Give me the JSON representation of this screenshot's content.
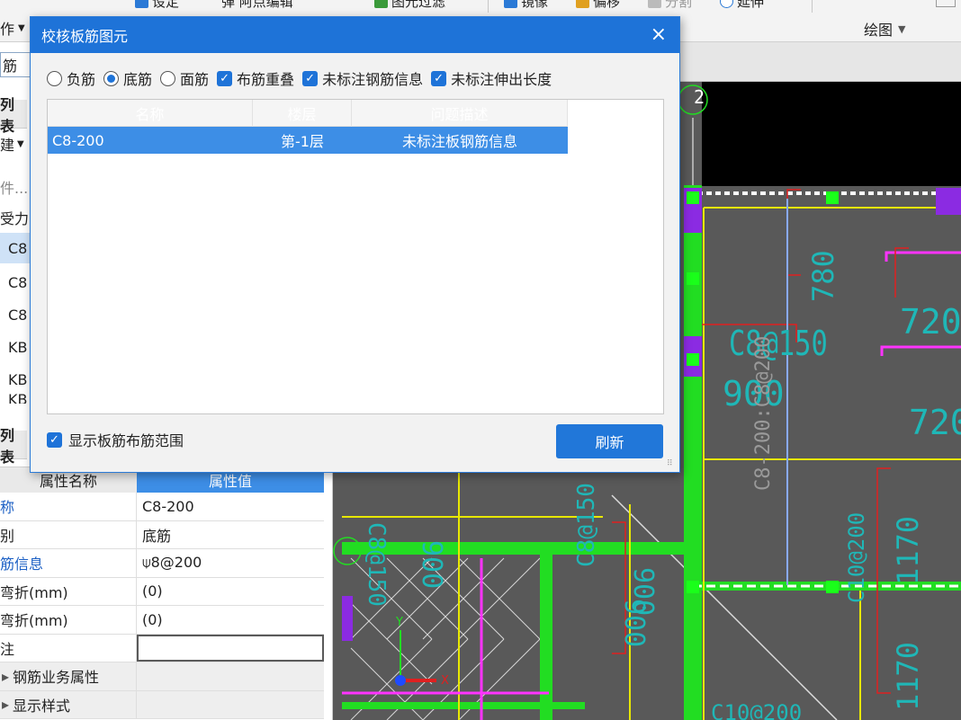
{
  "ribbon": {
    "items": [
      "设定",
      "弹 阿点编辑",
      "图元过滤",
      "镜像",
      "偏移",
      "分割",
      "延伸"
    ],
    "drawing_label": "绘图"
  },
  "left_panel": {
    "header_partial": "作",
    "input_partial": "筋",
    "list_header_partial": "列表",
    "new_partial": "建",
    "search_partial": "件...",
    "category_partial": "受力",
    "items": [
      "C8",
      "C8",
      "C8",
      "KB",
      "KB",
      "KB"
    ],
    "props_header_partial": "列表"
  },
  "property_grid": {
    "header_name": "属性名称",
    "header_value": "属性值",
    "rows": [
      {
        "name": "称",
        "value": "C8-200"
      },
      {
        "name": "别",
        "value": "底筋"
      },
      {
        "name": "筋信息",
        "value": "⍦8@200"
      },
      {
        "name": "弯折(mm)",
        "value": "(0)"
      },
      {
        "name": "弯折(mm)",
        "value": "(0)"
      },
      {
        "name": "注",
        "value": ""
      }
    ],
    "groups": [
      "钢筋业务属性",
      "显示样式"
    ]
  },
  "cad": {
    "labels": [
      "2",
      "C8@150",
      "900",
      "720",
      "720",
      "780",
      "C8-200:C8@200",
      "900",
      "900",
      "900",
      "C8@150",
      "C8@150",
      "C10@200",
      "C10@200",
      "1170",
      "1170",
      "Y",
      "X"
    ]
  },
  "dialog": {
    "title": "校核板筋图元",
    "close_glyph": "×",
    "options": {
      "neg_rebar": "负筋",
      "bottom_rebar": "底筋",
      "top_rebar": "面筋",
      "overlap": "布筋重叠",
      "no_rebar_info": "未标注钢筋信息",
      "no_extension": "未标注伸出长度"
    },
    "check_glyph": "✓",
    "table": {
      "headers": [
        "名称",
        "楼层",
        "问题描述"
      ],
      "rows": [
        {
          "name": "C8-200",
          "floor": "第-1层",
          "desc": "未标注板钢筋信息"
        }
      ]
    },
    "show_range_label": "显示板筋布筋范围",
    "refresh_label": "刷新"
  }
}
